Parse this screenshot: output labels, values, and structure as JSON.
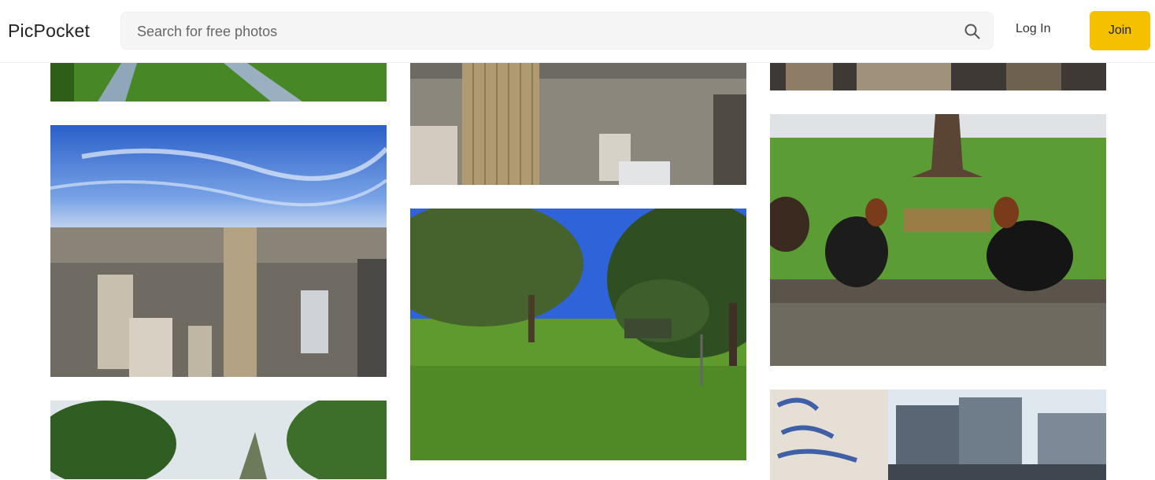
{
  "header": {
    "logo": "PicPocket",
    "search_placeholder": "Search for free photos",
    "login_label": "Log In",
    "join_label": "Join",
    "join_color": "#f5c000"
  },
  "icons": {
    "search": "search-icon"
  }
}
